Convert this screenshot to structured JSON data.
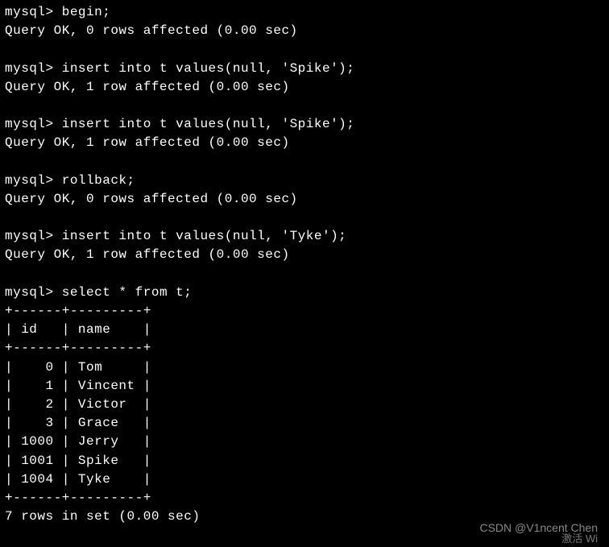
{
  "prompt": "mysql> ",
  "blocks": [
    {
      "cmd": "begin;",
      "resp": "Query OK, 0 rows affected (0.00 sec)"
    },
    {
      "cmd": "insert into t values(null, 'Spike');",
      "resp": "Query OK, 1 row affected (0.00 sec)"
    },
    {
      "cmd": "insert into t values(null, 'Spike');",
      "resp": "Query OK, 1 row affected (0.00 sec)"
    },
    {
      "cmd": "rollback;",
      "resp": "Query OK, 0 rows affected (0.00 sec)"
    },
    {
      "cmd": "insert into t values(null, 'Tyke');",
      "resp": "Query OK, 1 row affected (0.00 sec)"
    }
  ],
  "select_cmd": "select * from t;",
  "table": {
    "border_top": "+------+---------+",
    "header": "| id   | name    |",
    "border_mid": "+------+---------+",
    "rows": [
      "|    0 | Tom     |",
      "|    1 | Vincent |",
      "|    2 | Victor  |",
      "|    3 | Grace   |",
      "| 1000 | Jerry   |",
      "| 1001 | Spike   |",
      "| 1004 | Tyke    |"
    ],
    "border_bot": "+------+---------+",
    "footer": "7 rows in set (0.00 sec)"
  },
  "chart_data": {
    "type": "table",
    "columns": [
      "id",
      "name"
    ],
    "rows": [
      [
        0,
        "Tom"
      ],
      [
        1,
        "Vincent"
      ],
      [
        2,
        "Victor"
      ],
      [
        3,
        "Grace"
      ],
      [
        1000,
        "Jerry"
      ],
      [
        1001,
        "Spike"
      ],
      [
        1004,
        "Tyke"
      ]
    ]
  },
  "watermark": "CSDN @V1ncent Chen",
  "watermark_sub": "激活 Wi"
}
